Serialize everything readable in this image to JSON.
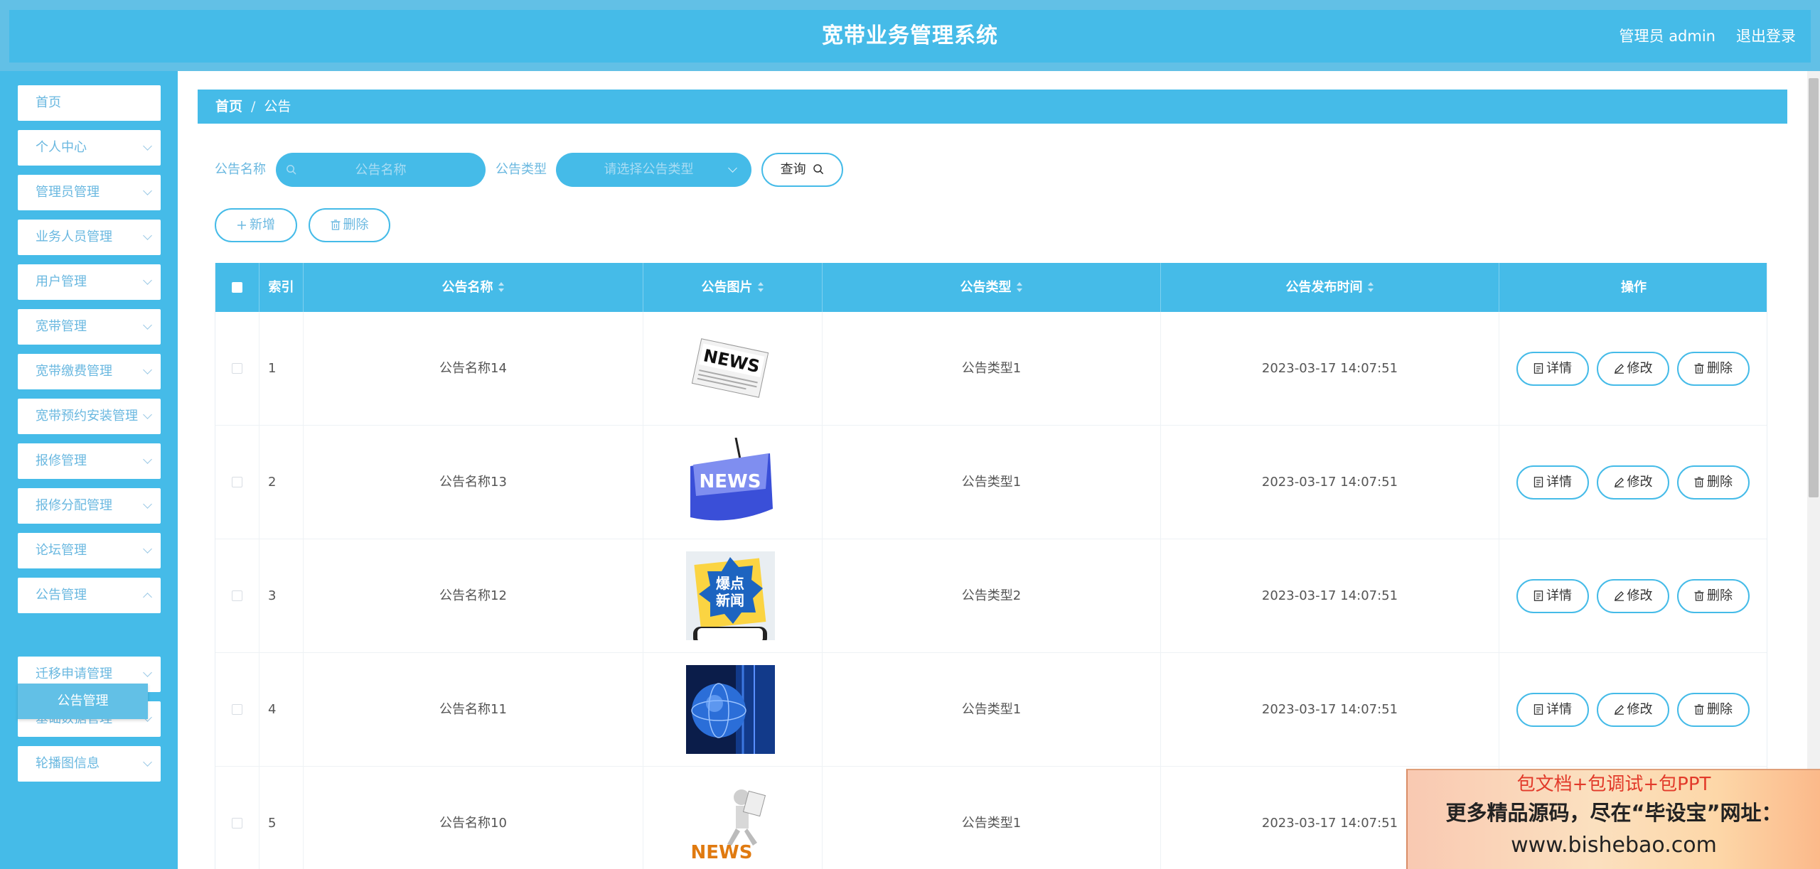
{
  "header": {
    "title": "宽带业务管理系统",
    "user": "管理员 admin",
    "logout": "退出登录"
  },
  "sidebar": {
    "items": [
      {
        "label": "首页",
        "has_arrow": false
      },
      {
        "label": "个人中心",
        "has_arrow": true
      },
      {
        "label": "管理员管理",
        "has_arrow": true
      },
      {
        "label": "业务人员管理",
        "has_arrow": true
      },
      {
        "label": "用户管理",
        "has_arrow": true
      },
      {
        "label": "宽带管理",
        "has_arrow": true
      },
      {
        "label": "宽带缴费管理",
        "has_arrow": true
      },
      {
        "label": "宽带预约安装管理",
        "has_arrow": true
      },
      {
        "label": "报修管理",
        "has_arrow": true
      },
      {
        "label": "报修分配管理",
        "has_arrow": true
      },
      {
        "label": "论坛管理",
        "has_arrow": true
      },
      {
        "label": "公告管理",
        "has_arrow": true,
        "open": true
      },
      {
        "label": "迁移申请管理",
        "has_arrow": true
      },
      {
        "label": "基础数据管理",
        "has_arrow": true
      },
      {
        "label": "轮播图信息",
        "has_arrow": true
      }
    ],
    "active_sub": "公告管理"
  },
  "breadcrumb": {
    "home": "首页",
    "separator": "/",
    "current": "公告"
  },
  "search": {
    "name_label": "公告名称",
    "name_placeholder": "公告名称",
    "type_label": "公告类型",
    "type_placeholder": "请选择公告类型",
    "query_button": "查询"
  },
  "toolbar": {
    "add_button": "新增",
    "delete_button": "删除"
  },
  "table": {
    "columns": [
      "索引",
      "公告名称",
      "公告图片",
      "公告类型",
      "公告发布时间",
      "操作"
    ],
    "sortable": [
      false,
      true,
      true,
      true,
      true,
      false
    ],
    "rows": [
      {
        "index": "1",
        "name": "公告名称14",
        "image": "news-newspaper",
        "type": "公告类型1",
        "time": "2023-03-17 14:07:51"
      },
      {
        "index": "2",
        "name": "公告名称13",
        "image": "news-key",
        "type": "公告类型1",
        "time": "2023-03-17 14:07:51"
      },
      {
        "index": "3",
        "name": "公告名称12",
        "image": "breaking-news-phone",
        "type": "公告类型2",
        "time": "2023-03-17 14:07:51"
      },
      {
        "index": "4",
        "name": "公告名称11",
        "image": "globe-digital",
        "type": "公告类型1",
        "time": "2023-03-17 14:07:51"
      },
      {
        "index": "5",
        "name": "公告名称10",
        "image": "news-figure",
        "type": "公告类型1",
        "time": "2023-03-17 14:07:51"
      }
    ],
    "actions": {
      "detail": "详情",
      "edit": "修改",
      "delete": "删除"
    }
  },
  "ad_banner": {
    "line1": "包文档+包调试+包PPT",
    "line2": "更多精品源码，尽在“毕设宝”网址：",
    "line3": "www.bishebao.com"
  },
  "colors": {
    "primary": "#45bbe8",
    "background": "#62c0e6",
    "muted_text": "#6ab8e0"
  }
}
